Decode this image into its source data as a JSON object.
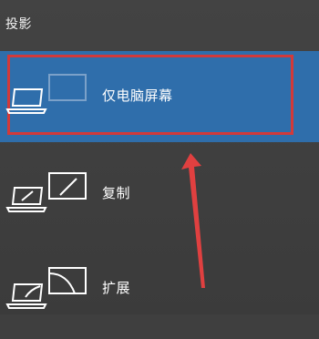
{
  "panel": {
    "title": "投影"
  },
  "options": [
    {
      "label": "仅电脑屏幕",
      "icon": "pc-screen-only-icon",
      "selected": true
    },
    {
      "label": "复制",
      "icon": "duplicate-icon",
      "selected": false
    },
    {
      "label": "扩展",
      "icon": "extend-icon",
      "selected": false
    }
  ],
  "colors": {
    "background": "#3f3f3f",
    "selected_bg": "#2f6eab",
    "highlight_border": "#d23a3a",
    "annotation_arrow": "#e04040"
  }
}
